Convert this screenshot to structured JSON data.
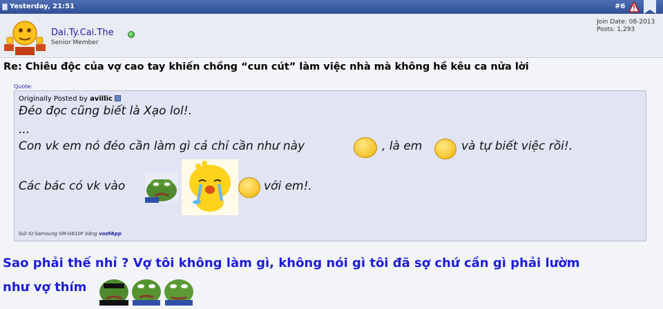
{
  "post_header": {
    "date": "Yesterday, 21:51",
    "post_number": "#6",
    "icons": [
      "document-icon",
      "report-icon",
      "bookmark-icon"
    ],
    "bar_color": "#3a5a9f"
  },
  "user": {
    "name": "Dai.Ty.Cai.The",
    "title": "Senior Member",
    "join_date": "Join Date: 08-2013",
    "posts": "Posts: 1,293",
    "status_icon": "online-icon",
    "name_color": "#22229c"
  },
  "post": {
    "title": "Re: Chiêu độc của vợ cao tay khiến chồng “cun cút” làm việc nhà mà không hề kêu ca nửa lời",
    "quote_label": "Quote:",
    "quote": {
      "originally_posted_by": "Originally Posted by ",
      "author": "avillic",
      "lines": [
        "Đéo đọc cũng biết là Xạo lol!.",
        "...",
        "Con vk em nó đéo cần làm gì cả chỉ cần như này",
        ", là em",
        "và tự biết việc rồi!.",
        "Các bác có vk vào",
        "với em!."
      ],
      "sent_from": "Gửi từ Samsung SM-G610F bằng ",
      "app": "vozFApp"
    },
    "reply_lines": [
      "Sao phải thế nhỉ ? Vợ tôi không làm gì, không nói gì tôi đã sợ chứ cần gì phải lườm",
      "như vợ thím"
    ],
    "reply_color": "#1d1dd6"
  }
}
